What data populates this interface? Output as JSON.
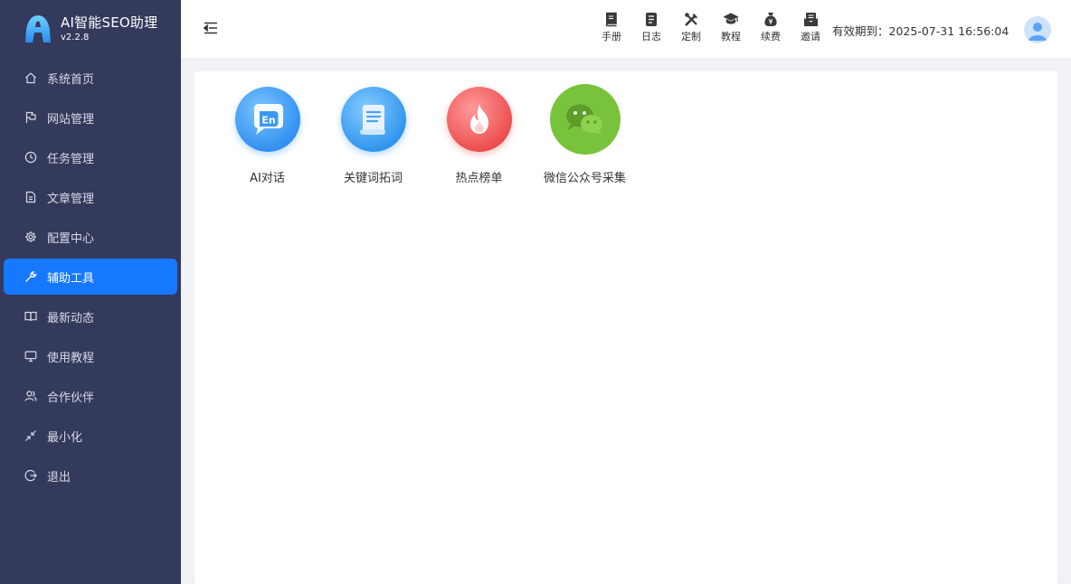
{
  "brand": {
    "title": "AI智能SEO助理",
    "version": "v2.2.8"
  },
  "sidebar": {
    "items": [
      {
        "label": "系统首页",
        "icon": "home-icon"
      },
      {
        "label": "网站管理",
        "icon": "flag-icon"
      },
      {
        "label": "任务管理",
        "icon": "clock-icon"
      },
      {
        "label": "文章管理",
        "icon": "document-icon"
      },
      {
        "label": "配置中心",
        "icon": "gear-icon"
      },
      {
        "label": "辅助工具",
        "icon": "wrench-icon",
        "active": true
      },
      {
        "label": "最新动态",
        "icon": "book-icon"
      },
      {
        "label": "使用教程",
        "icon": "monitor-icon"
      },
      {
        "label": "合作伙伴",
        "icon": "users-icon"
      },
      {
        "label": "最小化",
        "icon": "minimize-icon"
      },
      {
        "label": "退出",
        "icon": "logout-icon"
      }
    ]
  },
  "header": {
    "tools": [
      {
        "label": "手册",
        "icon": "manual-icon"
      },
      {
        "label": "日志",
        "icon": "log-icon"
      },
      {
        "label": "定制",
        "icon": "customize-icon"
      },
      {
        "label": "教程",
        "icon": "graduation-cap-icon"
      },
      {
        "label": "续费",
        "icon": "money-bag-icon"
      },
      {
        "label": "邀请",
        "icon": "invite-icon"
      }
    ],
    "expiry_label": "有效期到：",
    "expiry_value": "2025-07-31 16:56:04"
  },
  "apps": [
    {
      "label": "AI对话",
      "icon": "ai-chat-icon",
      "color": "#3d9cf3"
    },
    {
      "label": "关键词拓词",
      "icon": "keyword-scroll-icon",
      "color": "#3a9cf0"
    },
    {
      "label": "热点榜单",
      "icon": "hot-flame-icon",
      "color": "#f05a5a"
    },
    {
      "label": "微信公众号采集",
      "icon": "wechat-icon",
      "color": "#7cc53d"
    }
  ],
  "colors": {
    "sidebar_bg": "#343a5c",
    "accent": "#1677ff",
    "page_bg": "#f0f2f5"
  }
}
